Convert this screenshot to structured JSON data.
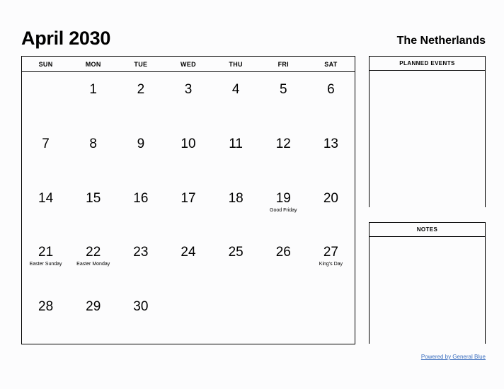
{
  "header": {
    "month_title": "April 2030",
    "region": "The Netherlands"
  },
  "calendar": {
    "weekdays": [
      "SUN",
      "MON",
      "TUE",
      "WED",
      "THU",
      "FRI",
      "SAT"
    ],
    "weeks": [
      [
        {
          "day": "",
          "event": ""
        },
        {
          "day": "1",
          "event": ""
        },
        {
          "day": "2",
          "event": ""
        },
        {
          "day": "3",
          "event": ""
        },
        {
          "day": "4",
          "event": ""
        },
        {
          "day": "5",
          "event": ""
        },
        {
          "day": "6",
          "event": ""
        }
      ],
      [
        {
          "day": "7",
          "event": ""
        },
        {
          "day": "8",
          "event": ""
        },
        {
          "day": "9",
          "event": ""
        },
        {
          "day": "10",
          "event": ""
        },
        {
          "day": "11",
          "event": ""
        },
        {
          "day": "12",
          "event": ""
        },
        {
          "day": "13",
          "event": ""
        }
      ],
      [
        {
          "day": "14",
          "event": ""
        },
        {
          "day": "15",
          "event": ""
        },
        {
          "day": "16",
          "event": ""
        },
        {
          "day": "17",
          "event": ""
        },
        {
          "day": "18",
          "event": ""
        },
        {
          "day": "19",
          "event": "Good Friday"
        },
        {
          "day": "20",
          "event": ""
        }
      ],
      [
        {
          "day": "21",
          "event": "Easter Sunday"
        },
        {
          "day": "22",
          "event": "Easter Monday"
        },
        {
          "day": "23",
          "event": ""
        },
        {
          "day": "24",
          "event": ""
        },
        {
          "day": "25",
          "event": ""
        },
        {
          "day": "26",
          "event": ""
        },
        {
          "day": "27",
          "event": "King's Day"
        }
      ],
      [
        {
          "day": "28",
          "event": ""
        },
        {
          "day": "29",
          "event": ""
        },
        {
          "day": "30",
          "event": ""
        },
        {
          "day": "",
          "event": ""
        },
        {
          "day": "",
          "event": ""
        },
        {
          "day": "",
          "event": ""
        },
        {
          "day": "",
          "event": ""
        }
      ]
    ]
  },
  "sidebar": {
    "planned_events": {
      "title": "PLANNED EVENTS",
      "content": ""
    },
    "notes": {
      "title": "NOTES",
      "content": ""
    }
  },
  "footer": {
    "link_label": "Powered by General Blue",
    "link_color": "#3c6fbf"
  }
}
